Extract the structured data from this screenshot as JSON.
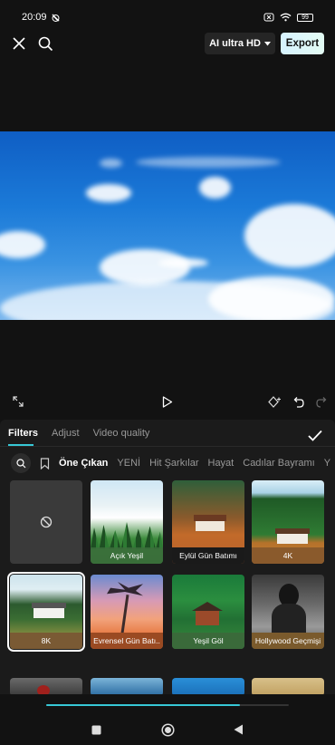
{
  "status": {
    "time": "20:09",
    "battery": "99"
  },
  "toolbar": {
    "quality_label": "AI ultra HD",
    "export_label": "Export"
  },
  "panel": {
    "tabs": [
      "Filters",
      "Adjust",
      "Video quality"
    ],
    "active_tab": "Filters",
    "categories": [
      "Öne Çıkan",
      "YENİ",
      "Hit Şarkılar",
      "Hayat",
      "Cadılar Bayramı",
      "Y"
    ],
    "active_category": "Öne Çıkan",
    "filters": [
      {
        "label": "",
        "type": "none"
      },
      {
        "label": "Açık Yeşil"
      },
      {
        "label": "Eylül Gün Batımı"
      },
      {
        "label": "4K"
      },
      {
        "label": "8K",
        "selected": true
      },
      {
        "label": "Evrensel Gün Batı.."
      },
      {
        "label": "Yeşil Göl"
      },
      {
        "label": "Hollywood Geçmişi"
      }
    ]
  },
  "scroll_progress": 0.8,
  "colors": {
    "accent": "#37c8d6",
    "export_bg": "#dff6ff"
  },
  "icons": [
    "close-icon",
    "search-icon",
    "fullscreen-icon",
    "play-icon",
    "keyframe-icon",
    "undo-icon",
    "redo-icon",
    "check-icon",
    "bookmark-icon",
    "no-filter-icon",
    "stop-icon",
    "home-icon",
    "back-icon"
  ]
}
